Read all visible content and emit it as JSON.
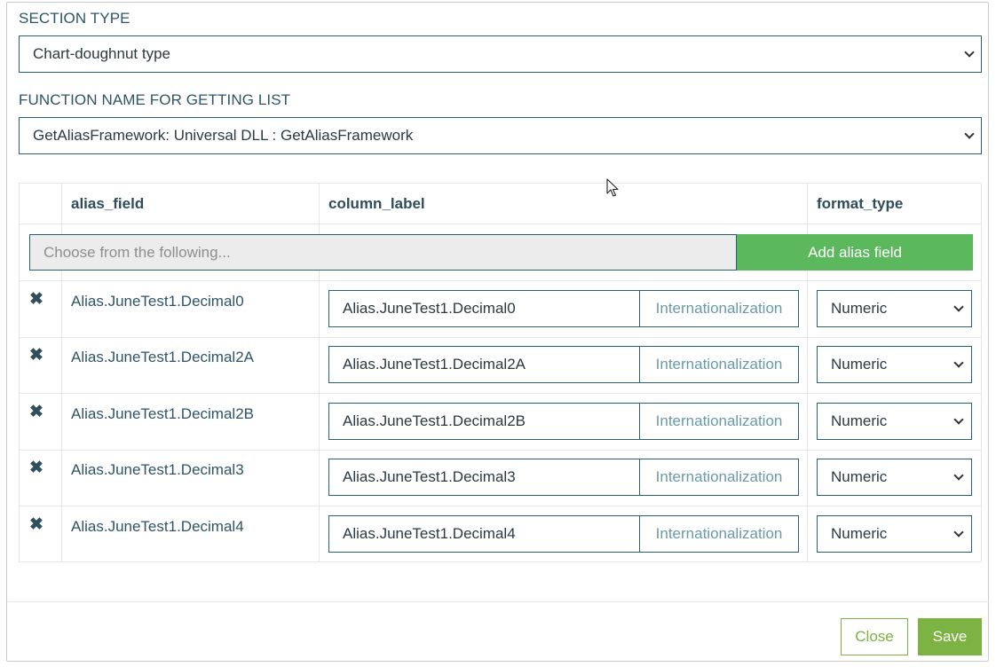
{
  "section_type": {
    "label": "SECTION TYPE",
    "selected": "Chart-doughnut type"
  },
  "function_name": {
    "label": "FUNCTION NAME FOR GETTING LIST",
    "selected": "GetAliasFramework: Universal DLL : GetAliasFramework"
  },
  "table": {
    "headers": [
      "",
      "alias_field",
      "column_label",
      "format_type"
    ],
    "choose_placeholder": "Choose from the following...",
    "add_button": "Add alias field",
    "rows": [
      {
        "alias_field": "Alias.JuneTest1.Decimal0",
        "column_label": "Alias.JuneTest1.Decimal0",
        "intl": "Internationalization",
        "format_type": "Numeric"
      },
      {
        "alias_field": "Alias.JuneTest1.Decimal2A",
        "column_label": "Alias.JuneTest1.Decimal2A",
        "intl": "Internationalization",
        "format_type": "Numeric"
      },
      {
        "alias_field": "Alias.JuneTest1.Decimal2B",
        "column_label": "Alias.JuneTest1.Decimal2B",
        "intl": "Internationalization",
        "format_type": "Numeric"
      },
      {
        "alias_field": "Alias.JuneTest1.Decimal3",
        "column_label": "Alias.JuneTest1.Decimal3",
        "intl": "Internationalization",
        "format_type": "Numeric"
      },
      {
        "alias_field": "Alias.JuneTest1.Decimal4",
        "column_label": "Alias.JuneTest1.Decimal4",
        "intl": "Internationalization",
        "format_type": "Numeric"
      }
    ],
    "delete_glyph": "✖"
  },
  "footer": {
    "close_label": "Close",
    "save_label": "Save"
  },
  "icons": {
    "delete": "delete-x-icon",
    "dropdown": "chevron-down-icon",
    "cursor": "mouse-pointer-icon"
  },
  "colors": {
    "primary_border": "#2b5f73",
    "add_button": "#5cb85c",
    "save_button": "#7cb342"
  }
}
